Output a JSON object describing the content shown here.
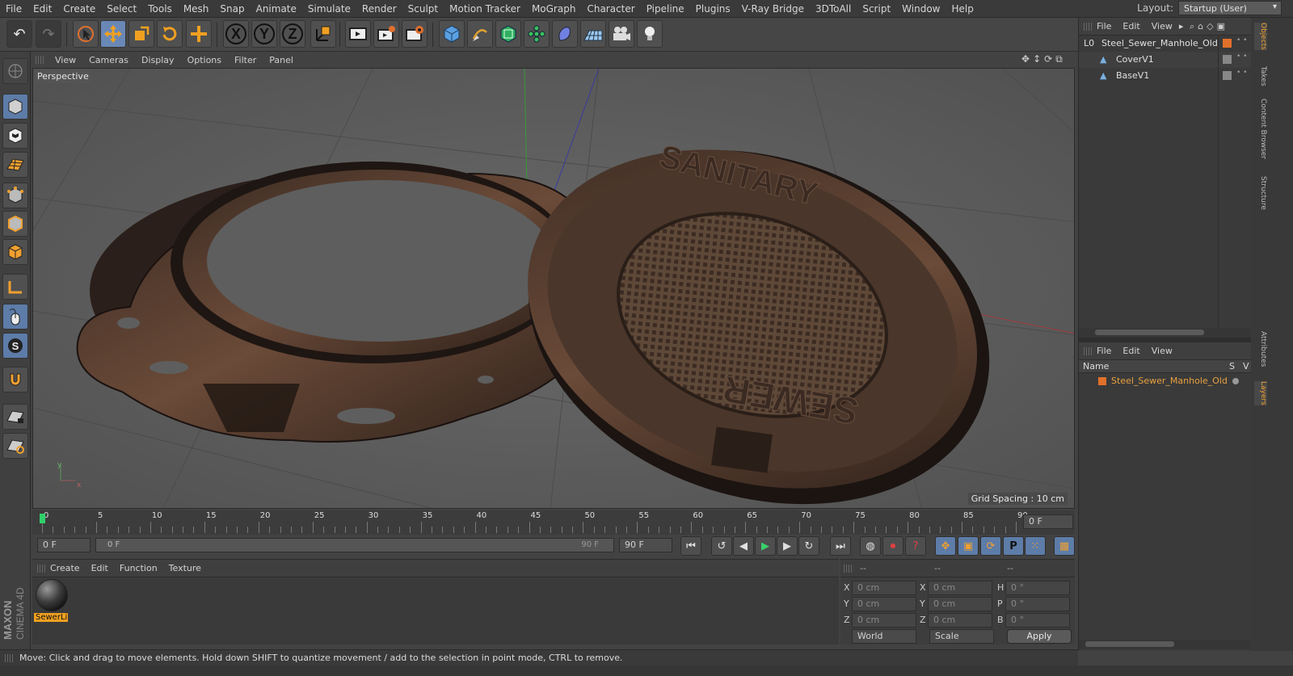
{
  "menubar": {
    "items": [
      "File",
      "Edit",
      "Create",
      "Select",
      "Tools",
      "Mesh",
      "Snap",
      "Animate",
      "Simulate",
      "Render",
      "Sculpt",
      "Motion Tracker",
      "MoGraph",
      "Character",
      "Pipeline",
      "Plugins",
      "V-Ray Bridge",
      "3DToAll",
      "Script",
      "Window",
      "Help"
    ],
    "layout_label": "Layout:",
    "layout_value": "Startup (User)"
  },
  "toolbar": {
    "axis_x": "X",
    "axis_y": "Y",
    "axis_z": "Z",
    "icons": [
      "undo-icon",
      "redo-icon",
      "live-selection-icon",
      "move-icon",
      "scale-icon",
      "rotate-icon",
      "add-icon",
      "x-axis-icon",
      "y-axis-icon",
      "z-axis-icon",
      "coordinate-system-icon",
      "render-view-icon",
      "render-picture-viewer-icon",
      "render-settings-icon",
      "cube-icon",
      "pen-icon",
      "subdivision-icon",
      "cloner-icon",
      "deformer-icon",
      "floor-icon",
      "camera-icon",
      "light-icon"
    ]
  },
  "viewport": {
    "menu": [
      "View",
      "Cameras",
      "Display",
      "Options",
      "Filter",
      "Panel"
    ],
    "label": "Perspective",
    "grid_spacing": "Grid Spacing : 10 cm",
    "axis_x": "x",
    "axis_y": "y",
    "embossed_top": "SANITARY",
    "embossed_bottom": "SEWER"
  },
  "timeline": {
    "ticks": [
      "0",
      "5",
      "10",
      "15",
      "20",
      "25",
      "30",
      "35",
      "40",
      "45",
      "50",
      "55",
      "60",
      "65",
      "70",
      "75",
      "80",
      "85",
      "90"
    ],
    "current_frame": "0 F",
    "min_frame": "0 F",
    "range_start": "0 F",
    "range_end": "90 F",
    "max_frame": "90 F"
  },
  "material_manager": {
    "menu": [
      "Create",
      "Edit",
      "Function",
      "Texture"
    ],
    "material_name": "SewerLi"
  },
  "coordinates": {
    "header_a": "--",
    "header_b": "--",
    "header_c": "--",
    "rows": [
      {
        "a_label": "X",
        "a_value": "0 cm",
        "b_label": "X",
        "b_value": "0 cm",
        "c_label": "H",
        "c_value": "0 °"
      },
      {
        "a_label": "Y",
        "a_value": "0 cm",
        "b_label": "Y",
        "b_value": "0 cm",
        "c_label": "P",
        "c_value": "0 °"
      },
      {
        "a_label": "Z",
        "a_value": "0 cm",
        "b_label": "Z",
        "b_value": "0 cm",
        "c_label": "B",
        "c_value": "0 °"
      }
    ],
    "mode1": "World",
    "mode2": "Scale",
    "apply": "Apply"
  },
  "objects_panel": {
    "menu": [
      "File",
      "Edit",
      "View"
    ],
    "objects": [
      {
        "name": "Steel_Sewer_Manhole_Old",
        "indent": 0
      },
      {
        "name": "CoverV1",
        "indent": 1
      },
      {
        "name": "BaseV1",
        "indent": 1
      }
    ]
  },
  "layers_panel": {
    "menu": [
      "File",
      "Edit",
      "View"
    ],
    "col_name": "Name",
    "col_s": "S",
    "col_v": "V",
    "layers": [
      "Steel_Sewer_Manhole_Old"
    ]
  },
  "side_tabs": [
    "Objects",
    "Takes",
    "Content Browser",
    "Structure",
    "Attributes",
    "Layers"
  ],
  "status": "Move: Click and drag to move elements. Hold down SHIFT to quantize movement / add to the selection in point mode, CTRL to remove.",
  "branding": {
    "maxon": "MAXON",
    "cinema": "CINEMA 4D"
  },
  "colors": {
    "accent_orange": "#e0702a",
    "tool_blue": "#6a88b6",
    "layer_text": "#e8a040"
  }
}
